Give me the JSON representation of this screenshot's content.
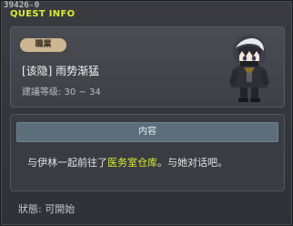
{
  "window": {
    "quest_id": "39426-0",
    "title": "QUEST INFO"
  },
  "header": {
    "job_badge": "職業",
    "quest_name": "[该隐] 雨势渐猛",
    "level_range": "建議等级: 30 ~ 34",
    "npc_icon": "npc-portrait-icon"
  },
  "content": {
    "heading": "内容",
    "text_before": "与伊林一起前往了",
    "highlight": "医务室仓库",
    "text_after": "。与她对话吧。"
  },
  "status": {
    "text": "狀態: 可開始"
  },
  "colors": {
    "title": "#d9ec32",
    "badge": "#cdb791",
    "content_header": "#5c6e7a",
    "highlight": "#d9ec32"
  }
}
